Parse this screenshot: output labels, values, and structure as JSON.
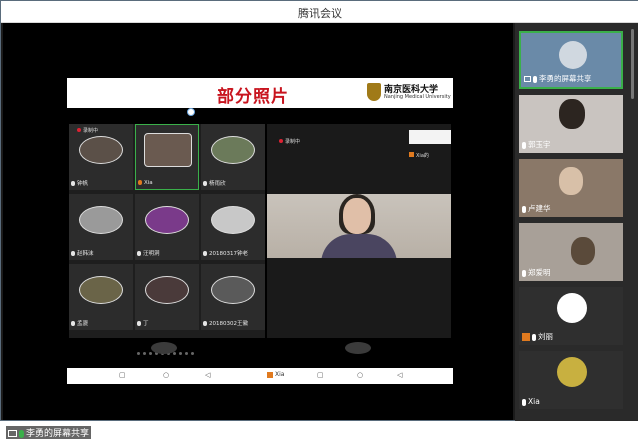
{
  "window": {
    "title": "腾讯会议"
  },
  "slide": {
    "title": "部分照片",
    "logo_cn": "南京医科大学",
    "logo_en": "Nanjing Medical University"
  },
  "grid": {
    "recording_label": "录制中",
    "participants": [
      {
        "name": "钟帆"
      },
      {
        "name": "Xia"
      },
      {
        "name": "杨雨欣"
      },
      {
        "name": "赵韩沫"
      },
      {
        "name": "汪明洞"
      },
      {
        "name": "20180317钟老"
      },
      {
        "name": "孟骁"
      },
      {
        "name": "丁"
      },
      {
        "name": "20180302王徽"
      }
    ]
  },
  "speaker": {
    "recording_label": "录制中",
    "thumb_name": "Xia的",
    "bottom_name": "Xia"
  },
  "share_label": "李勇的屏幕共享",
  "sidebar": {
    "tiles": [
      {
        "label": "李勇的屏幕共享"
      },
      {
        "label": "郭玉宇"
      },
      {
        "label": "卢建华"
      },
      {
        "label": "郑爱明"
      },
      {
        "label": "刘丽"
      },
      {
        "label": "Xia"
      }
    ]
  },
  "colors": {
    "accent_green": "#3ab04a",
    "slide_title_red": "#c8141e",
    "host_orange": "#e07a1f"
  }
}
